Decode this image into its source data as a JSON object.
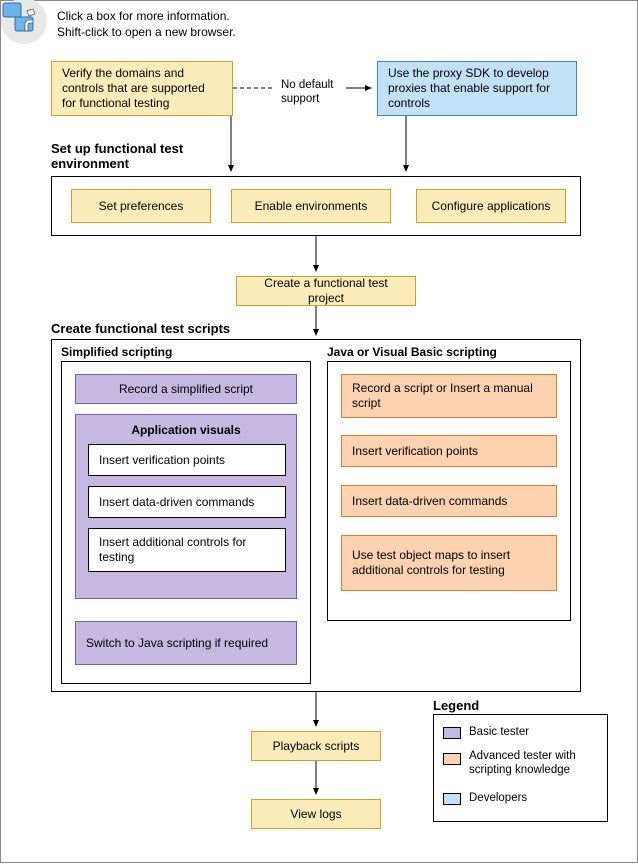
{
  "hint": {
    "line1": "Click a box for more information.",
    "line2": "Shift-click to open a new browser."
  },
  "top": {
    "verify": "Verify the domains and controls that are supported for functional testing",
    "no_default": "No default support",
    "proxy": "Use the proxy SDK to develop proxies that enable support for controls"
  },
  "setup": {
    "title": "Set up functional test environment",
    "pref": "Set preferences",
    "env": "Enable environments",
    "cfg": "Configure applications"
  },
  "create_project": "Create a functional test project",
  "scripts": {
    "title": "Create functional test scripts",
    "simplified": {
      "title": "Simplified scripting",
      "record": "Record a simplified script",
      "appvis_title": "Application visuals",
      "verif": "Insert verification points",
      "dd": "Insert data-driven commands",
      "addl": "Insert additional controls for testing",
      "switch": "Switch to Java scripting if required"
    },
    "java": {
      "title": "Java or Visual Basic scripting",
      "record": "Record a script or Insert a manual script",
      "verif": "Insert verification points",
      "dd": "Insert data-driven commands",
      "maps": "Use test object maps to insert additional controls for testing"
    }
  },
  "playback": "Playback scripts",
  "logs": "View logs",
  "legend": {
    "title": "Legend",
    "basic": "Basic tester",
    "advanced": "Advanced tester with scripting knowledge",
    "dev": "Developers"
  }
}
